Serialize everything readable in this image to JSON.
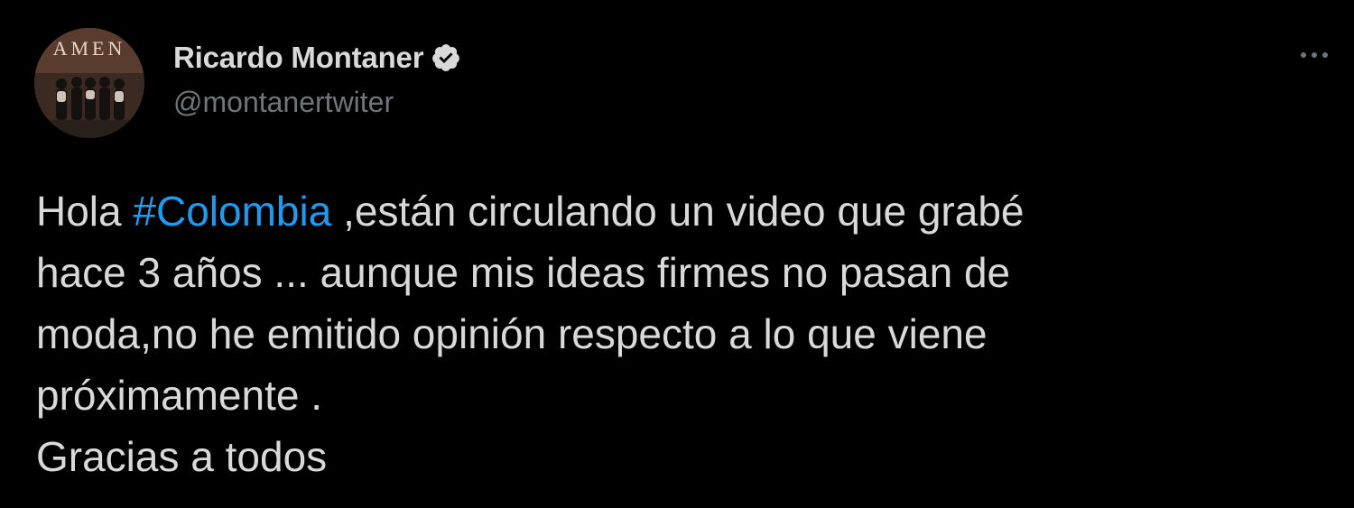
{
  "author": {
    "display_name": "Ricardo Montaner",
    "handle": "@montanertwiter",
    "verified": true,
    "verified_icon": "verified-badge-icon",
    "avatar_icon": "profile-photo",
    "avatar_text": "AMEN"
  },
  "menu": {
    "icon": "more-options-icon",
    "glyph": "···"
  },
  "tweet": {
    "line1_before": "Hola ",
    "hashtag": "#Colombia",
    "line1_after": " ,están circulando un video que grabé",
    "line2": "hace 3 años ... aunque mis ideas firmes no pasan de",
    "line3": "moda,no he emitido opinión respecto a lo que viene",
    "line4": "próximamente .",
    "line5": "Gracias a todos"
  },
  "colors": {
    "background": "#000000",
    "text": "#d9d9d9",
    "secondary": "#6e767d",
    "link": "#1d9bf0"
  }
}
